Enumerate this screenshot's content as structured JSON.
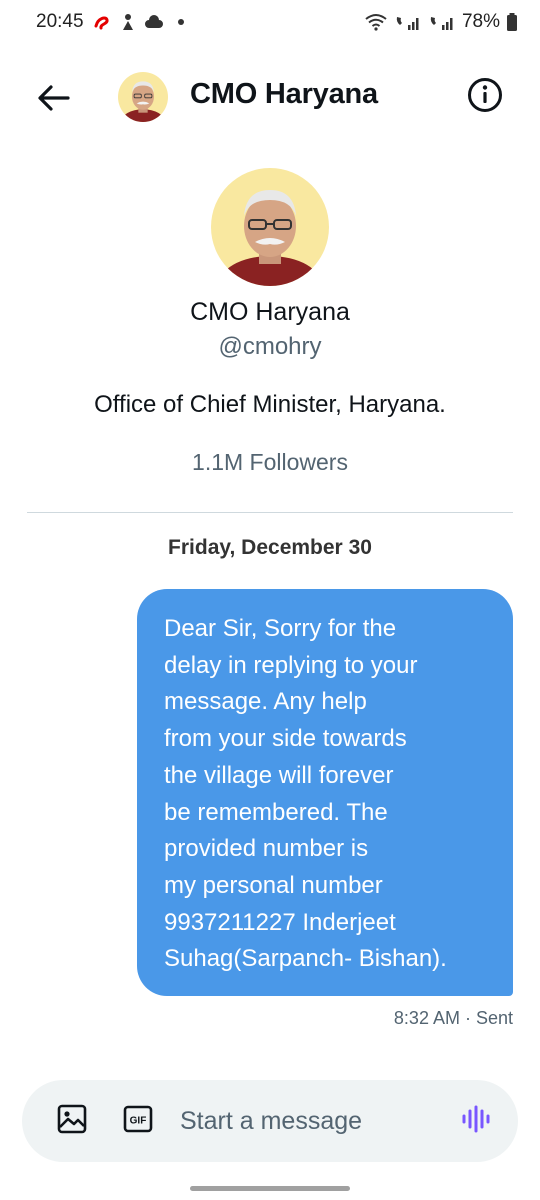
{
  "status_bar": {
    "time": "20:45",
    "battery": "78%",
    "icons": [
      "airtel-icon",
      "notification-icon",
      "cloud-icon",
      "wifi-icon",
      "signal-sim1-icon",
      "signal-sim2-icon",
      "battery-icon"
    ]
  },
  "header": {
    "title": "CMO Haryana",
    "back_icon": "arrow-left-icon",
    "info_icon": "info-icon"
  },
  "profile": {
    "name": "CMO Haryana",
    "handle": "@cmohry",
    "bio": "Office of Chief Minister, Haryana.",
    "followers": "1.1M Followers"
  },
  "conversation": {
    "date_separator": "Friday, December 30",
    "messages": [
      {
        "text": "Dear Sir, Sorry for the\ndelay in replying to your\nmessage.  Any help\nfrom your side towards\nthe village will forever\nbe remembered. The\nprovided number is\nmy personal number\n9937211227 Inderjeet\nSuhag(Sarpanch- Bishan).",
        "meta": "8:32 AM · Sent",
        "direction": "outgoing"
      }
    ]
  },
  "composer": {
    "placeholder": "Start a message",
    "value": "",
    "icons": [
      "image-icon",
      "gif-icon",
      "voice-icon"
    ]
  },
  "colors": {
    "bubble": "#4a98e8",
    "voice_accent": "#7856ff",
    "secondary_text": "#536471"
  }
}
